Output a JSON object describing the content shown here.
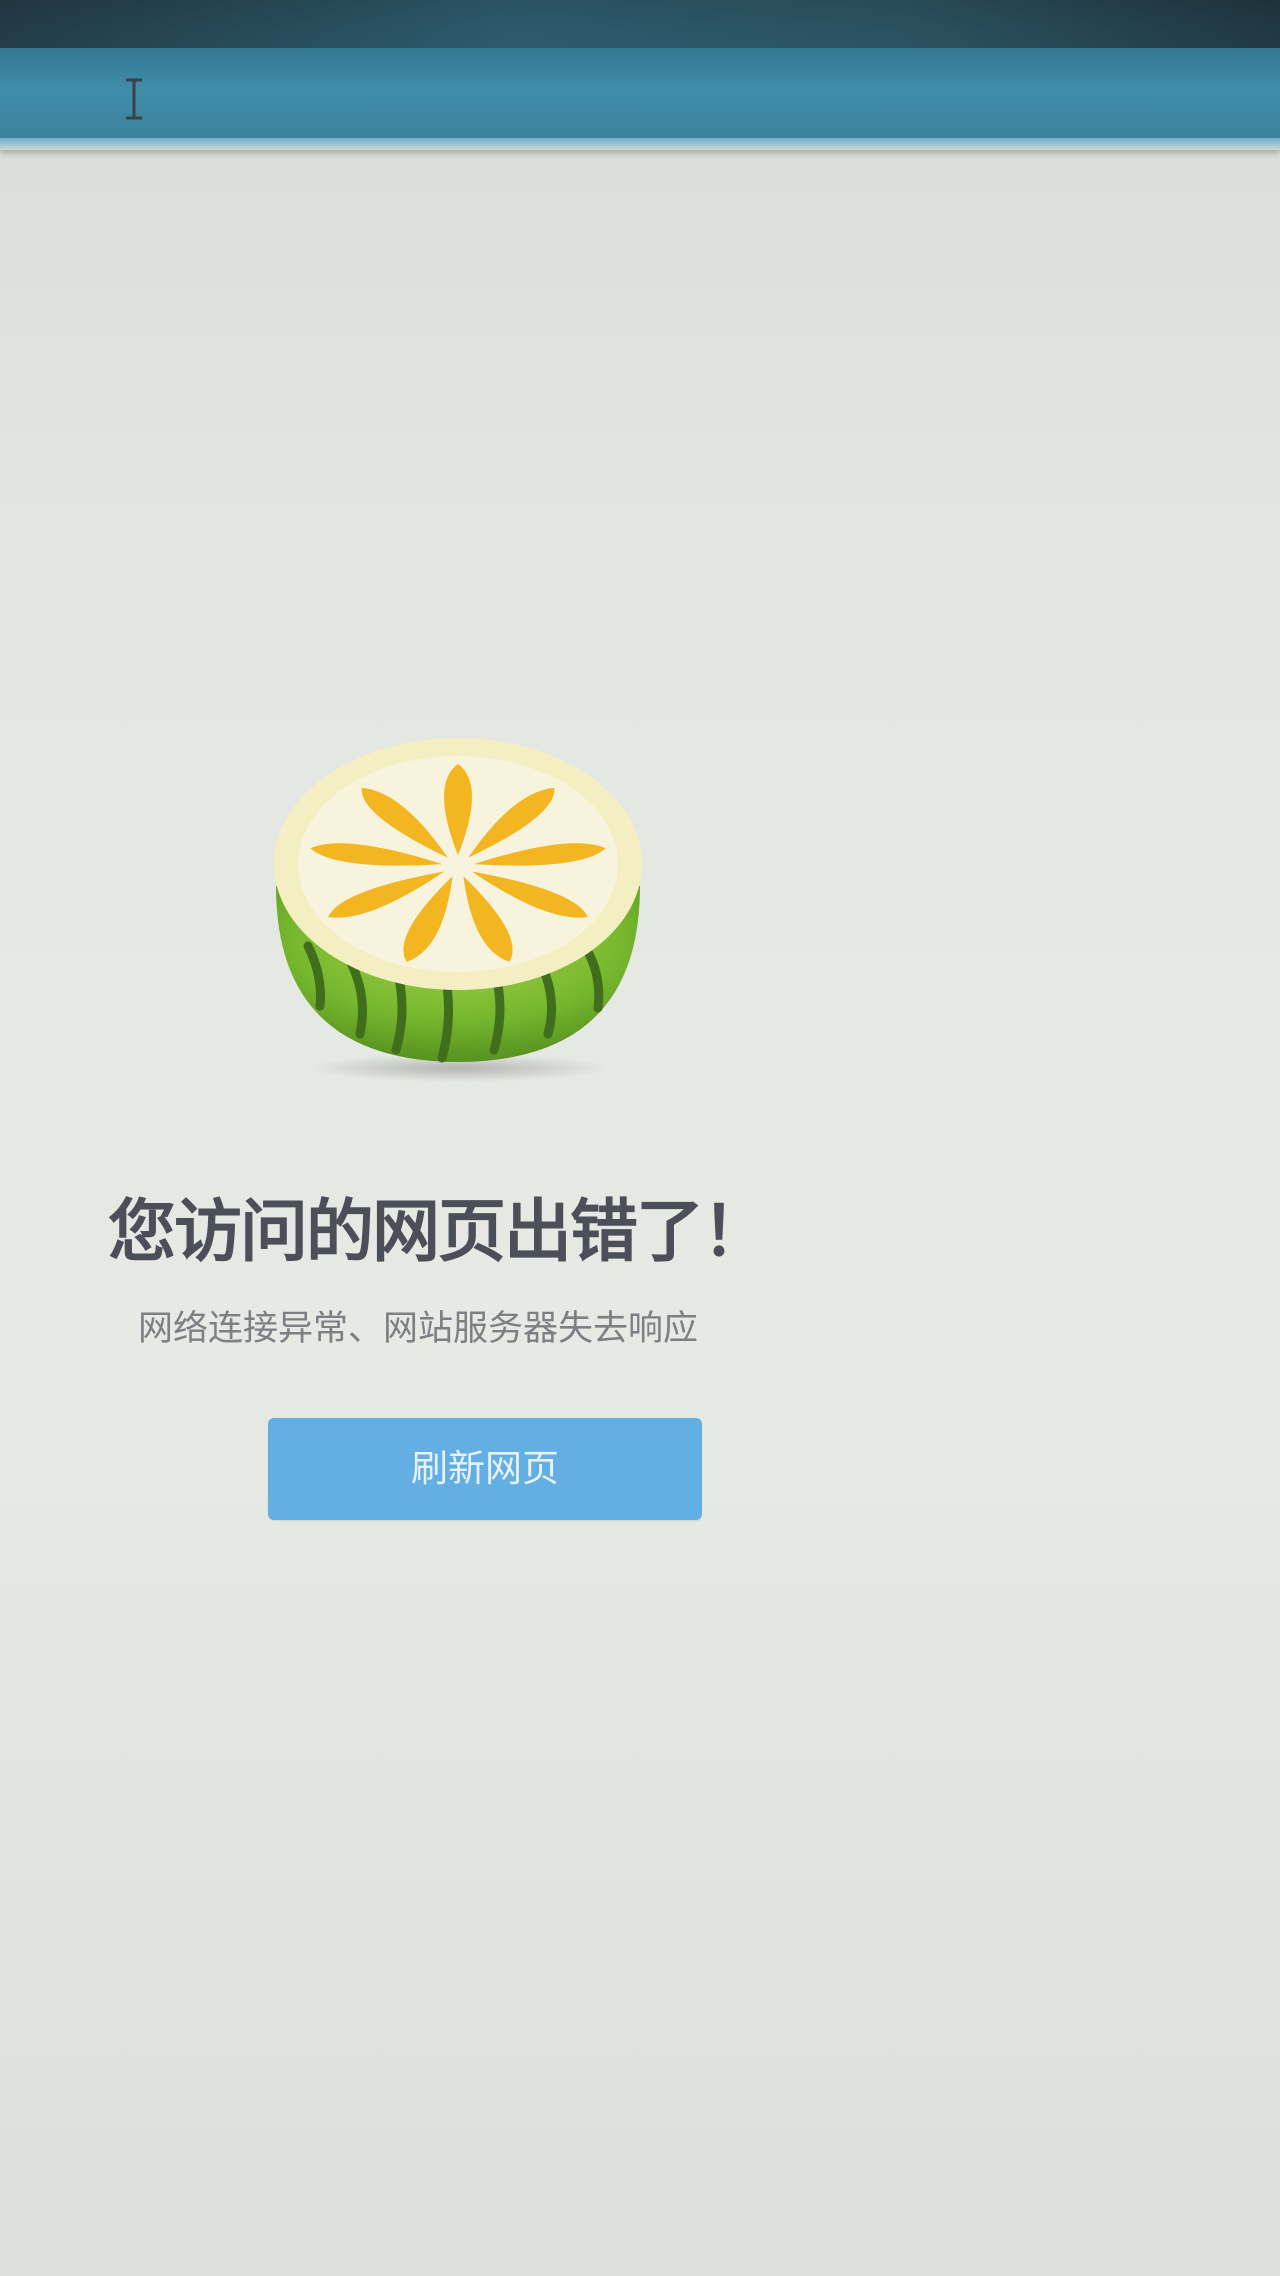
{
  "error_page": {
    "title": "您访问的网页出错了！",
    "description": "网络连接异常、网站服务器失去响应",
    "refresh_button_label": "刷新网页"
  },
  "icons": {
    "illustration": "watermelon-lemon-icon",
    "cursor": "text-cursor-icon"
  },
  "colors": {
    "button_background": "#63aee3",
    "title_text": "#4b4f58",
    "description_text": "#7c7f84",
    "top_bar": "#3f8daa"
  }
}
